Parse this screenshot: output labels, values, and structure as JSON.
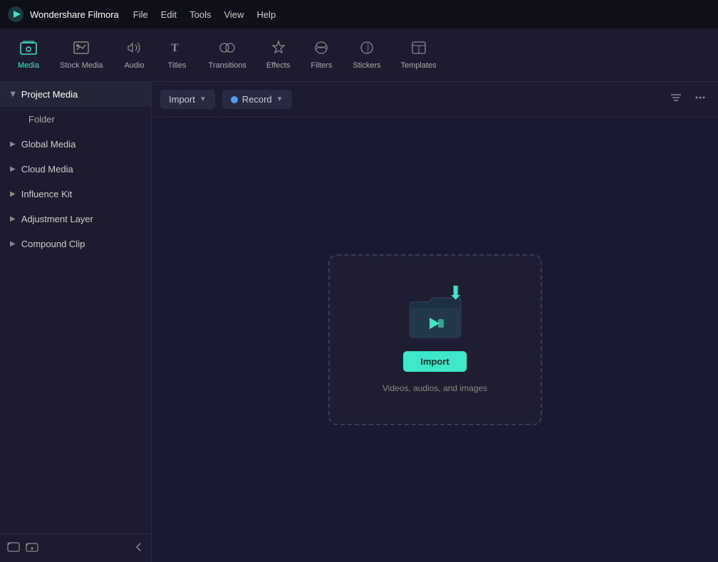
{
  "app": {
    "name": "Wondershare Filmora",
    "logo_char": "🎬"
  },
  "menu": {
    "items": [
      "File",
      "Edit",
      "Tools",
      "View",
      "Help"
    ]
  },
  "toolbar": {
    "items": [
      {
        "id": "media",
        "label": "Media",
        "icon": "media",
        "active": true
      },
      {
        "id": "stock-media",
        "label": "Stock Media",
        "icon": "stock"
      },
      {
        "id": "audio",
        "label": "Audio",
        "icon": "audio"
      },
      {
        "id": "titles",
        "label": "Titles",
        "icon": "titles"
      },
      {
        "id": "transitions",
        "label": "Transitions",
        "icon": "transitions"
      },
      {
        "id": "effects",
        "label": "Effects",
        "icon": "effects"
      },
      {
        "id": "filters",
        "label": "Filters",
        "icon": "filters"
      },
      {
        "id": "stickers",
        "label": "Stickers",
        "icon": "stickers"
      },
      {
        "id": "templates",
        "label": "Templates",
        "icon": "templates"
      }
    ]
  },
  "sidebar": {
    "items": [
      {
        "id": "project-media",
        "label": "Project Media",
        "expanded": true,
        "active": true
      },
      {
        "id": "folder",
        "label": "Folder",
        "sub": true
      },
      {
        "id": "global-media",
        "label": "Global Media",
        "expanded": false
      },
      {
        "id": "cloud-media",
        "label": "Cloud Media",
        "expanded": false
      },
      {
        "id": "influence-kit",
        "label": "Influence Kit",
        "expanded": false
      },
      {
        "id": "adjustment-layer",
        "label": "Adjustment Layer",
        "expanded": false
      },
      {
        "id": "compound-clip",
        "label": "Compound Clip",
        "expanded": false
      }
    ]
  },
  "content_toolbar": {
    "import_label": "Import",
    "record_label": "Record",
    "filter_icon_title": "Filter",
    "more_icon_title": "More"
  },
  "drop_zone": {
    "import_button_label": "Import",
    "hint_text": "Videos, audios, and images"
  }
}
